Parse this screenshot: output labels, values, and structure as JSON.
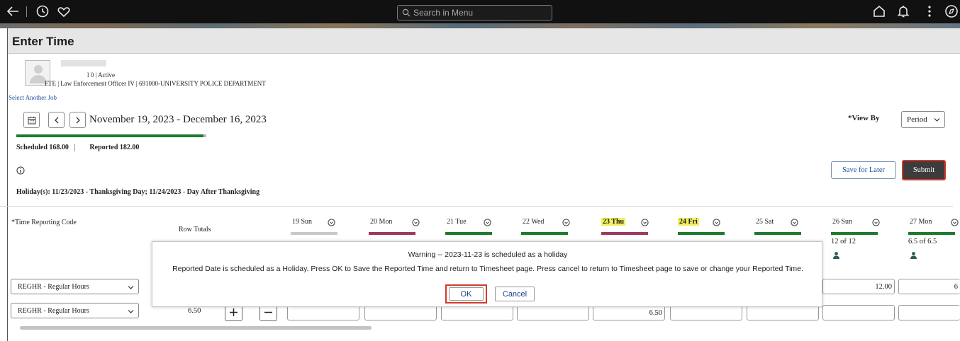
{
  "topbar": {
    "search_placeholder": "Search in Menu"
  },
  "page": {
    "title": "Enter Time"
  },
  "employee": {
    "status_line": "l 0 | Active",
    "job_line": "FTE | Law Enforcement Officer IV | 691000-UNIVERSITY POLICE DEPARTMENT",
    "select_job_link": "Select Another Job"
  },
  "period": {
    "date_range": "November 19, 2023 - December 16, 2023",
    "view_by_label": "*View By",
    "view_by_value": "Period",
    "scheduled_progress": 0.92
  },
  "summary": {
    "scheduled_label": "Scheduled",
    "scheduled_value": "168.00",
    "reported_label": "Reported",
    "reported_value": "182.00"
  },
  "actions": {
    "save_later": "Save for Later",
    "submit": "Submit"
  },
  "holiday_text": "Holiday(s): 11/23/2023 - Thanksgiving Day; 11/24/2023 - Day After Thanksgiving",
  "grid": {
    "trc_header": "*Time Reporting Code",
    "row_totals_header": "Row Totals",
    "days": [
      {
        "label": "19 Sun",
        "highlight": false,
        "bar": "gray",
        "amount": ""
      },
      {
        "label": "20 Mon",
        "highlight": false,
        "bar": "pink",
        "amount": ""
      },
      {
        "label": "21 Tue",
        "highlight": false,
        "bar": "green",
        "amount": ""
      },
      {
        "label": "22 Wed",
        "highlight": false,
        "bar": "green",
        "amount": ""
      },
      {
        "label": "23 Thu",
        "highlight": true,
        "bar": "pink",
        "amount": ""
      },
      {
        "label": "24 Fri",
        "highlight": true,
        "bar": "green",
        "amount": ""
      },
      {
        "label": "25 Sat",
        "highlight": false,
        "bar": "green",
        "amount": ""
      },
      {
        "label": "26 Sun",
        "highlight": false,
        "bar": "green",
        "amount": "12 of 12"
      },
      {
        "label": "27 Mon",
        "highlight": false,
        "bar": "green",
        "amount": "6.5 of 6.5"
      }
    ],
    "rows": [
      {
        "trc": "REGHR - Regular Hours",
        "total": "",
        "col26": "12.00",
        "col27": "6"
      },
      {
        "trc": "REGHR - Regular Hours",
        "total": "6.50",
        "col23": "6.50"
      }
    ]
  },
  "modal": {
    "title": "Warning -- 2023-11-23 is scheduled as  a holiday",
    "message": "Reported Date is scheduled as a Holiday. Press OK to Save the Reported Time and return to Timesheet page. Press cancel to return to Timesheet page to save or change your Reported Time.",
    "ok": "OK",
    "cancel": "Cancel"
  }
}
